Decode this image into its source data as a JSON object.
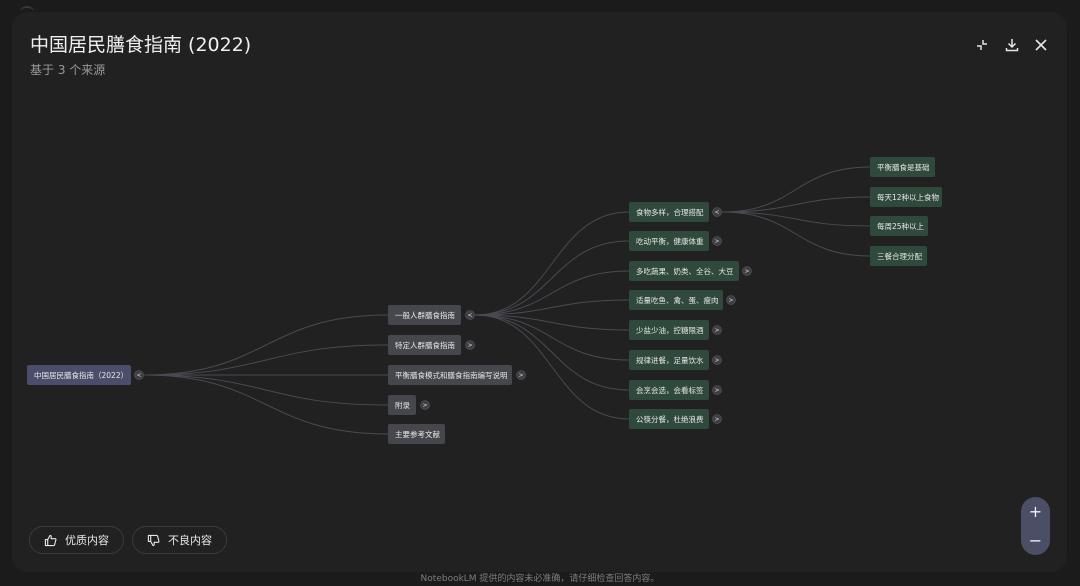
{
  "header": {
    "title": "中国居民膳食指南 (2022)",
    "subtitle": "基于 3 个来源"
  },
  "toolbar": {
    "collapse_icon": "collapse-icon",
    "download_icon": "download-icon",
    "close_icon": "close-icon"
  },
  "mindmap": {
    "root": {
      "label": "中国居民膳食指南（2022）",
      "toggle": "<"
    },
    "level1": [
      {
        "label": "一般人群膳食指南",
        "toggle": "<"
      },
      {
        "label": "特定人群膳食指南",
        "toggle": ">"
      },
      {
        "label": "平衡膳食模式和膳食指南编写说明",
        "toggle": ">"
      },
      {
        "label": "附录",
        "toggle": ">"
      },
      {
        "label": "主要参考文献",
        "toggle": ""
      }
    ],
    "level2": [
      {
        "label": "食物多样，合理搭配",
        "toggle": "<"
      },
      {
        "label": "吃动平衡，健康体重",
        "toggle": ">"
      },
      {
        "label": "多吃蔬果、奶类、全谷、大豆",
        "toggle": ">"
      },
      {
        "label": "适量吃鱼、禽、蛋、瘦肉",
        "toggle": ">"
      },
      {
        "label": "少盐少油，控糖限酒",
        "toggle": ">"
      },
      {
        "label": "规律进餐，足量饮水",
        "toggle": ">"
      },
      {
        "label": "会烹会选，会看标签",
        "toggle": ">"
      },
      {
        "label": "公筷分餐，杜绝浪费",
        "toggle": ">"
      }
    ],
    "level3": [
      {
        "label": "平衡膳食是基础"
      },
      {
        "label": "每天12种以上食物"
      },
      {
        "label": "每周25种以上"
      },
      {
        "label": "三餐合理分配"
      }
    ]
  },
  "feedback": {
    "good_label": "优质内容",
    "bad_label": "不良内容"
  },
  "zoom": {
    "in_label": "+",
    "out_label": "−"
  },
  "footer": {
    "text": "NotebookLM 提供的内容未必准确，请仔细检查回答内容。"
  },
  "colors": {
    "root_node": "#4a4e6a",
    "level1_node": "#45474d",
    "leaf_node": "#2f4a3c",
    "zoom_button": "#4a4f66"
  }
}
